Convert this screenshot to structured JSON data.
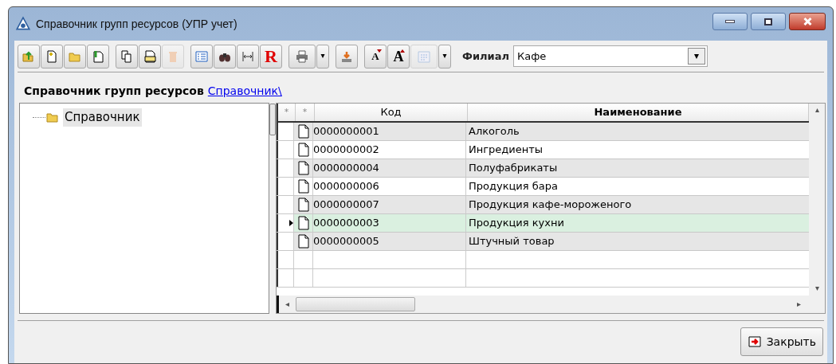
{
  "window": {
    "title": "Справочник групп ресурсов (УПР учет)"
  },
  "toolbar": {
    "groups": [
      {
        "buttons": [
          {
            "kind": "icon",
            "disabled": false
          },
          {
            "kind": "icon",
            "disabled": false
          },
          {
            "kind": "icon",
            "disabled": false
          },
          {
            "kind": "icon",
            "disabled": false
          }
        ]
      },
      {
        "buttons": [
          {
            "kind": "icon",
            "disabled": false
          },
          {
            "kind": "icon",
            "disabled": false
          },
          {
            "kind": "icon",
            "disabled": true
          }
        ]
      },
      {
        "buttons": [
          {
            "kind": "icon",
            "disabled": false
          },
          {
            "kind": "icon",
            "disabled": false
          },
          {
            "kind": "icon",
            "disabled": false
          },
          {
            "kind": "letter",
            "text": "R",
            "disabled": false
          }
        ]
      },
      {
        "buttons": [
          {
            "kind": "split",
            "disabled": false
          }
        ]
      },
      {
        "buttons": [
          {
            "kind": "icon",
            "disabled": false
          }
        ]
      },
      {
        "buttons": [
          {
            "kind": "letter_small",
            "text": "A",
            "disabled": false
          },
          {
            "kind": "letter_big",
            "text": "A",
            "disabled": false
          },
          {
            "kind": "split",
            "disabled": true
          }
        ]
      }
    ],
    "branch": {
      "label": "Филиал",
      "value": "Кафе"
    }
  },
  "breadcrumb": {
    "title": "Справочник групп ресурсов",
    "link": "Справочник\\"
  },
  "tree": {
    "items": [
      {
        "label": "Справочник",
        "selected": true
      }
    ]
  },
  "table": {
    "columns": [
      {
        "label": "*",
        "sorted": false
      },
      {
        "label": "*",
        "sorted": false
      },
      {
        "label": "Код",
        "sorted": false
      },
      {
        "label": "Наименование",
        "sorted": true
      }
    ],
    "rows": [
      {
        "code": "0000000001",
        "name": "Алкоголь",
        "selected": false
      },
      {
        "code": "0000000002",
        "name": "Ингредиенты",
        "selected": false
      },
      {
        "code": "0000000004",
        "name": "Полуфабрикаты",
        "selected": false
      },
      {
        "code": "0000000006",
        "name": "Продукция бара",
        "selected": false
      },
      {
        "code": "0000000007",
        "name": "Продукция кафе-мороженого",
        "selected": false
      },
      {
        "code": "0000000003",
        "name": "Продукция кухни",
        "selected": true
      },
      {
        "code": "0000000005",
        "name": "Штучный товар",
        "selected": false
      }
    ]
  },
  "buttons": [
    {
      "label": "Закрыть"
    }
  ]
}
